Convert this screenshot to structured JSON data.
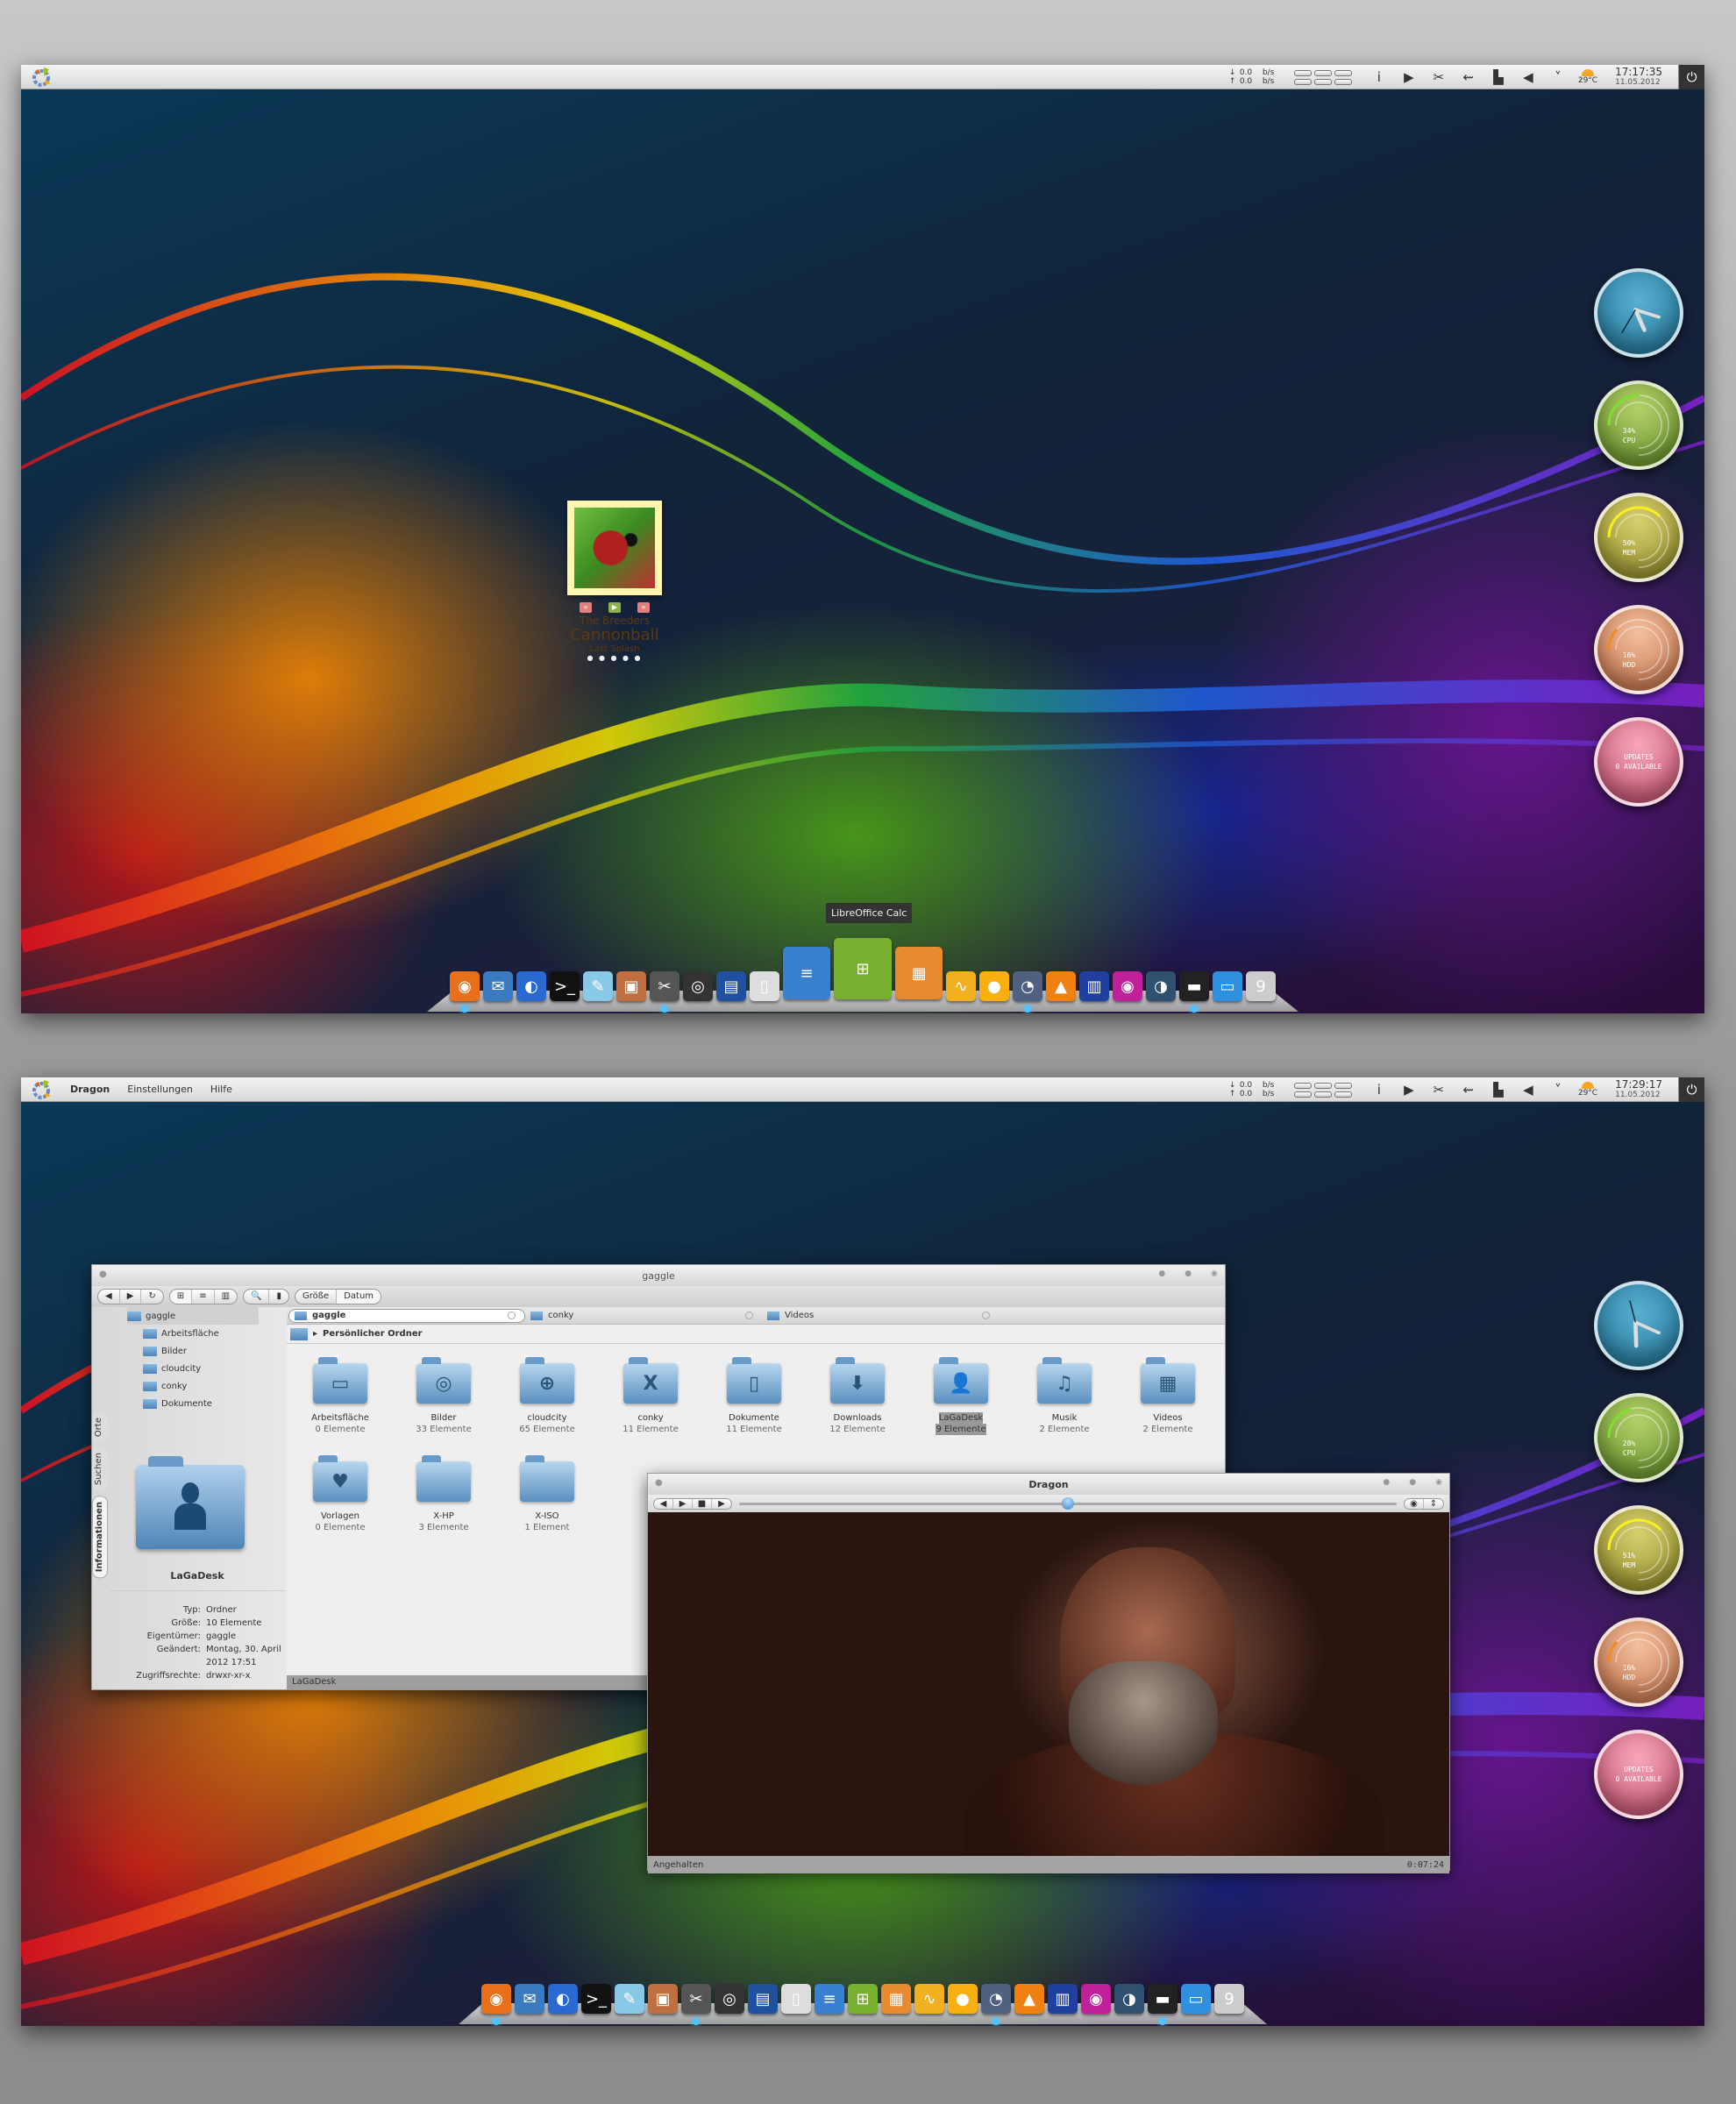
{
  "screens": [
    {
      "topbar": {
        "app_menu": [],
        "net_down": "0.0",
        "net_up": "0.0",
        "net_unit": "b/s",
        "weather_temp": "29°C",
        "time": "17:17:35",
        "date": "11.05.2012"
      },
      "gauges": {
        "cpu": {
          "value": "34%",
          "label": "CPU",
          "fraction": 0.34
        },
        "mem": {
          "value": "50%",
          "label": "MEM",
          "fraction": 0.5
        },
        "hdd": {
          "value": "16%",
          "label": "HDD",
          "fraction": 0.16
        },
        "updates": {
          "line1": "UPDATES",
          "line2": "0 AVAILABLE"
        }
      },
      "music": {
        "artist": "The Breeders",
        "song": "Cannonball",
        "album": "Last Splash",
        "prev": "«",
        "play": "▶",
        "next": "»",
        "pages": "● ● ● ● ●"
      },
      "dock_tooltip": "LibreOffice Calc"
    },
    {
      "topbar": {
        "app_menu": [
          "Dragon",
          "Einstellungen",
          "Hilfe"
        ],
        "net_down": "0.0",
        "net_up": "0.0",
        "net_unit": "b/s",
        "weather_temp": "29°C",
        "time": "17:29:17",
        "date": "11.05.2012"
      },
      "gauges": {
        "cpu": {
          "value": "28%",
          "label": "CPU",
          "fraction": 0.28
        },
        "mem": {
          "value": "51%",
          "label": "MEM",
          "fraction": 0.51
        },
        "hdd": {
          "value": "16%",
          "label": "HDD",
          "fraction": 0.16
        },
        "updates": {
          "line1": "UPDATES",
          "line2": "0 AVAILABLE"
        }
      }
    }
  ],
  "tray_icons": [
    "info-icon",
    "play-icon",
    "scissors-icon",
    "usb-icon",
    "network-icon",
    "volume-icon",
    "chevron-down-icon"
  ],
  "dock": [
    {
      "name": "firefox",
      "glyph": "◉",
      "color": "#e8701a",
      "running": true
    },
    {
      "name": "thunderbird",
      "glyph": "✉",
      "color": "#3a7ac0",
      "running": false
    },
    {
      "name": "browser",
      "glyph": "◐",
      "color": "#2a6ad0",
      "running": false
    },
    {
      "name": "terminal",
      "glyph": ">_",
      "color": "#111111",
      "running": false
    },
    {
      "name": "text-editor",
      "glyph": "✎",
      "color": "#8ac8e8",
      "running": false
    },
    {
      "name": "package-manager",
      "glyph": "▣",
      "color": "#c07040",
      "running": false
    },
    {
      "name": "system-settings",
      "glyph": "✂",
      "color": "#555555",
      "running": true
    },
    {
      "name": "screenshot",
      "glyph": "◎",
      "color": "#333333",
      "running": false
    },
    {
      "name": "scanner",
      "glyph": "▤",
      "color": "#2050a0",
      "running": false
    },
    {
      "name": "libreoffice",
      "glyph": "▯",
      "color": "#dddddd",
      "running": false
    },
    {
      "name": "libreoffice-writer",
      "glyph": "≡",
      "color": "#3a80d0",
      "running": false
    },
    {
      "name": "libreoffice-calc",
      "glyph": "⊞",
      "color": "#7ab030",
      "running": false
    },
    {
      "name": "libreoffice-impress",
      "glyph": "▦",
      "color": "#e88a30",
      "running": false
    },
    {
      "name": "libreoffice-draw",
      "glyph": "∿",
      "color": "#f0b020",
      "running": false
    },
    {
      "name": "stuffit",
      "glyph": "●",
      "color": "#f8b010",
      "running": false
    },
    {
      "name": "wolf-app",
      "glyph": "◔",
      "color": "#506080",
      "running": true
    },
    {
      "name": "vlc",
      "glyph": "▲",
      "color": "#f08010",
      "running": false
    },
    {
      "name": "video-editor",
      "glyph": "▥",
      "color": "#2040a0",
      "running": false
    },
    {
      "name": "eye-app",
      "glyph": "◉",
      "color": "#c0209a",
      "running": false
    },
    {
      "name": "gimp",
      "glyph": "◑",
      "color": "#305070",
      "running": false
    },
    {
      "name": "printer",
      "glyph": "▬",
      "color": "#222222",
      "running": true
    },
    {
      "name": "display",
      "glyph": "▭",
      "color": "#3090e0",
      "running": false
    },
    {
      "name": "trash",
      "glyph": "9",
      "color": "#cccccc",
      "running": false
    }
  ],
  "dolphin": {
    "title": "gaggle",
    "view_sort": [
      "Größe",
      "Datum"
    ],
    "tree": [
      "gaggle",
      "Arbeitsfläche",
      "Bilder",
      "cloudcity",
      "conky",
      "Dokumente"
    ],
    "side_tabs": [
      "Orte",
      "Suchen",
      "Informationen"
    ],
    "info": {
      "name": "LaGaDesk",
      "rows": [
        {
          "k": "Typ:",
          "v": "Ordner"
        },
        {
          "k": "Größe:",
          "v": "10 Elemente"
        },
        {
          "k": "Eigentümer:",
          "v": "gaggle"
        },
        {
          "k": "Geändert:",
          "v": "Montag, 30. April 2012 17:51"
        },
        {
          "k": "Zugriffsrechte:",
          "v": "drwxr-xr-x"
        }
      ]
    },
    "tabs": [
      "gaggle",
      "conky",
      "Videos"
    ],
    "path": "Persönlicher Ordner",
    "items": [
      {
        "name": "Arbeitsfläche",
        "count": "0 Elemente",
        "glyph": "▭"
      },
      {
        "name": "Bilder",
        "count": "33 Elemente",
        "glyph": "◎"
      },
      {
        "name": "cloudcity",
        "count": "65 Elemente",
        "glyph": "⊕"
      },
      {
        "name": "conky",
        "count": "11 Elemente",
        "glyph": "X"
      },
      {
        "name": "Dokumente",
        "count": "11 Elemente",
        "glyph": "▯"
      },
      {
        "name": "Downloads",
        "count": "12 Elemente",
        "glyph": "⬇"
      },
      {
        "name": "LaGaDesk",
        "count": "9 Elemente",
        "glyph": "👤",
        "selected": true
      },
      {
        "name": "Musik",
        "count": "2 Elemente",
        "glyph": "♫"
      },
      {
        "name": "Videos",
        "count": "2 Elemente",
        "glyph": "▦"
      },
      {
        "name": "Vorlagen",
        "count": "0 Elemente",
        "glyph": "♥"
      },
      {
        "name": "X-HP",
        "count": "3 Elemente",
        "glyph": ""
      },
      {
        "name": "X-ISO",
        "count": "1 Element",
        "glyph": ""
      }
    ],
    "status": "LaGaDesk"
  },
  "dragon": {
    "title": "Dragon",
    "status": "Angehalten",
    "time": "0:07:24",
    "position_fraction": 0.5
  }
}
